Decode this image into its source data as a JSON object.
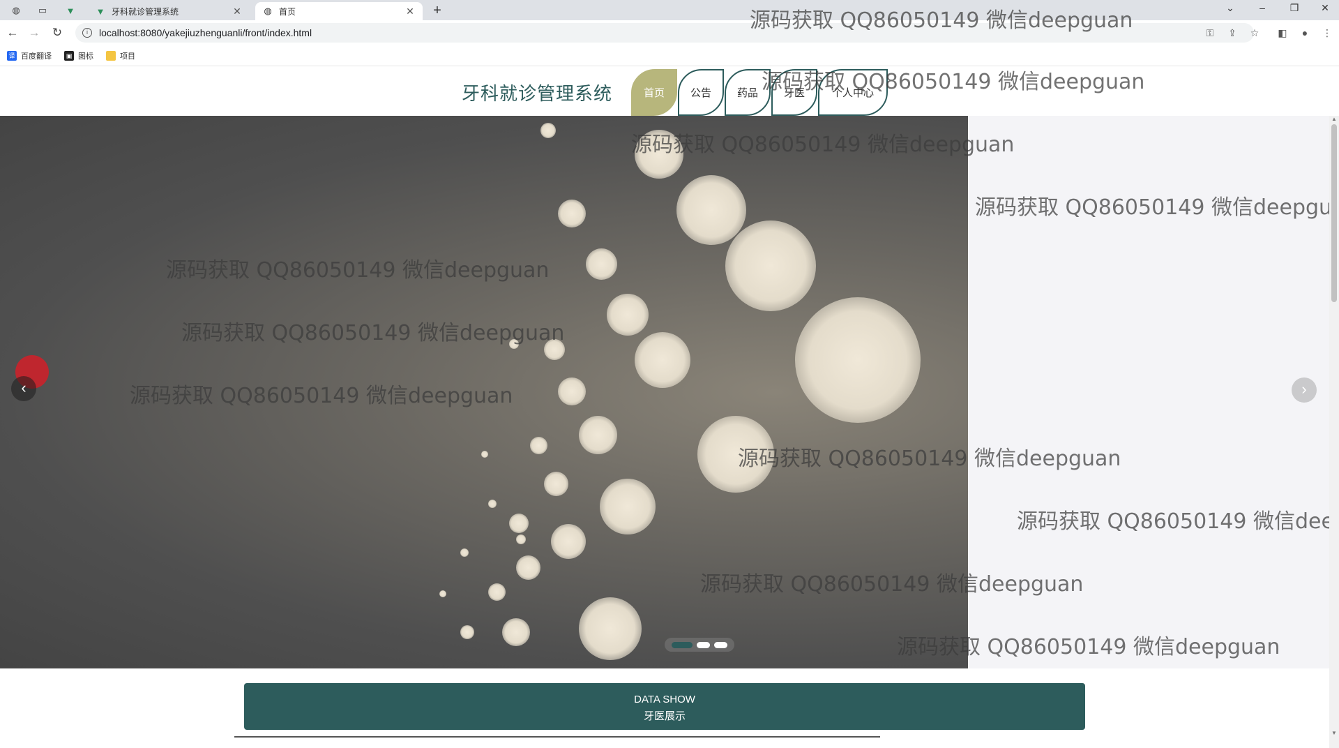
{
  "browser": {
    "tabs": [
      {
        "title": ""
      },
      {
        "title": ""
      },
      {
        "title": "牙科就诊管理系统"
      },
      {
        "title": "首页"
      }
    ],
    "new_tab": "+",
    "url": "localhost:8080/yakejiuzhenguanli/front/index.html",
    "bookmarks": [
      {
        "label": "百度翻译"
      },
      {
        "label": "图标"
      },
      {
        "label": "项目"
      }
    ]
  },
  "site": {
    "title": "牙科就诊管理系统",
    "nav": [
      {
        "label": "首页",
        "active": true
      },
      {
        "label": "公告",
        "active": false
      },
      {
        "label": "药品",
        "active": false
      },
      {
        "label": "牙医",
        "active": false
      },
      {
        "label": "个人中心",
        "active": false
      }
    ]
  },
  "carousel": {
    "prev_arrow": "‹",
    "next_arrow": "›",
    "slide_count": 3,
    "active_index": 0
  },
  "watermark_text": "源码获取 QQ86050149 微信deepguan",
  "section": {
    "title_en": "DATA SHOW",
    "title_cn": "牙医展示"
  },
  "colors": {
    "primary": "#2d5c5c",
    "nav_active": "#b7b67c"
  }
}
